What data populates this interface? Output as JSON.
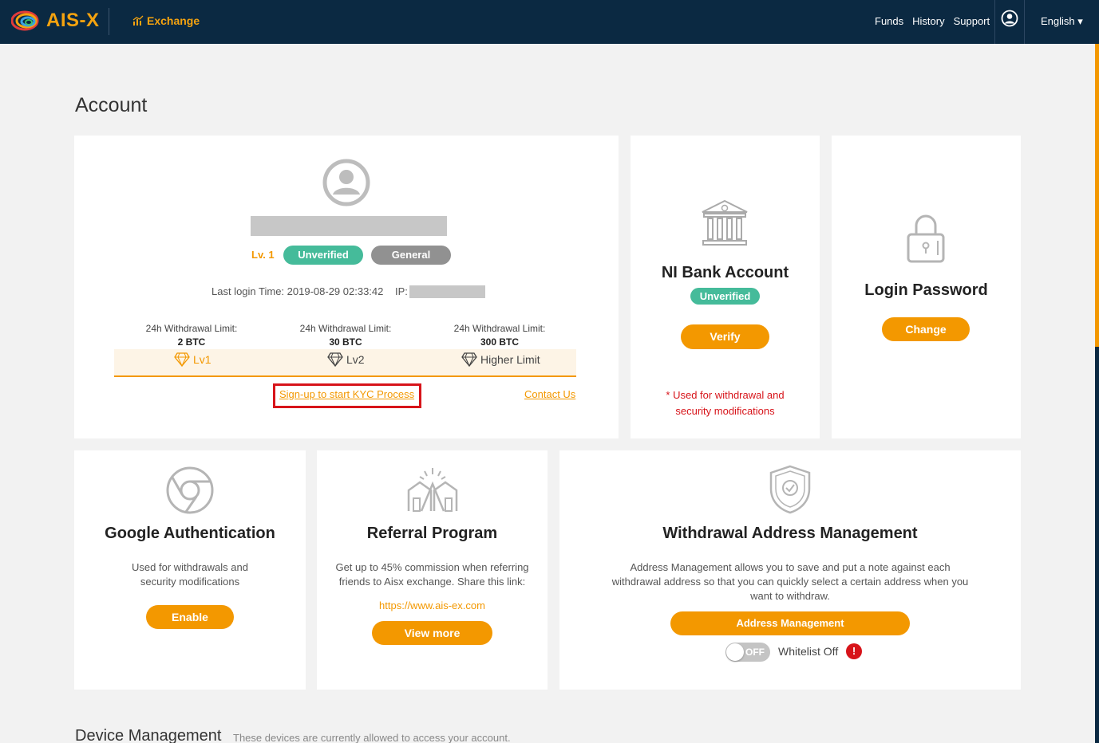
{
  "header": {
    "logo_text": "AIS-X",
    "exchange_label": "Exchange",
    "nav": [
      "Funds",
      "History",
      "Support"
    ],
    "language": "English ▾"
  },
  "page_title": "Account",
  "profile": {
    "level": "Lv. 1",
    "status_badge": "Unverified",
    "type_badge": "General",
    "last_login": "Last login Time: 2019-08-29 02:33:42",
    "ip_label": "IP:",
    "limits": [
      {
        "label": "24h Withdrawal Limit:",
        "value": "2 BTC",
        "level": "Lv1"
      },
      {
        "label": "24h Withdrawal Limit:",
        "value": "30 BTC",
        "level": "Lv2"
      },
      {
        "label": "24h Withdrawal Limit:",
        "value": "300 BTC",
        "level": "Higher Limit"
      }
    ],
    "kyc_link": "Sign-up to start KYC Process",
    "contact_link": "Contact Us"
  },
  "bank": {
    "title": "NI Bank Account",
    "status": "Unverified",
    "button": "Verify",
    "note_line1": "* Used for withdrawal and",
    "note_line2": "security modifications"
  },
  "password": {
    "title": "Login Password",
    "button": "Change"
  },
  "google": {
    "title": "Google Authentication",
    "desc_line1": "Used for withdrawals and",
    "desc_line2": "security modifications",
    "button": "Enable"
  },
  "referral": {
    "title": "Referral Program",
    "desc_line1": "Get up to 45% commission when referring",
    "desc_line2": "friends to Aisx exchange. Share this link:",
    "link": "https://www.ais-ex.com",
    "button": "View more"
  },
  "withdrawal": {
    "title": "Withdrawal Address Management",
    "desc_line1": "Address Management allows you to save and put a note against each",
    "desc_line2": "withdrawal address so that you can quickly select a certain address when you",
    "desc_line3": "want to withdraw.",
    "button": "Address Management",
    "toggle_label": "OFF",
    "whitelist_label": "Whitelist Off",
    "warn_symbol": "!"
  },
  "device": {
    "title": "Device Management",
    "subtitle": "These devices are currently allowed to access your account."
  },
  "colors": {
    "header_bg": "#0b2942",
    "accent": "#f39800",
    "verified_green": "#45bb9a",
    "alert_red": "#d7141a"
  }
}
